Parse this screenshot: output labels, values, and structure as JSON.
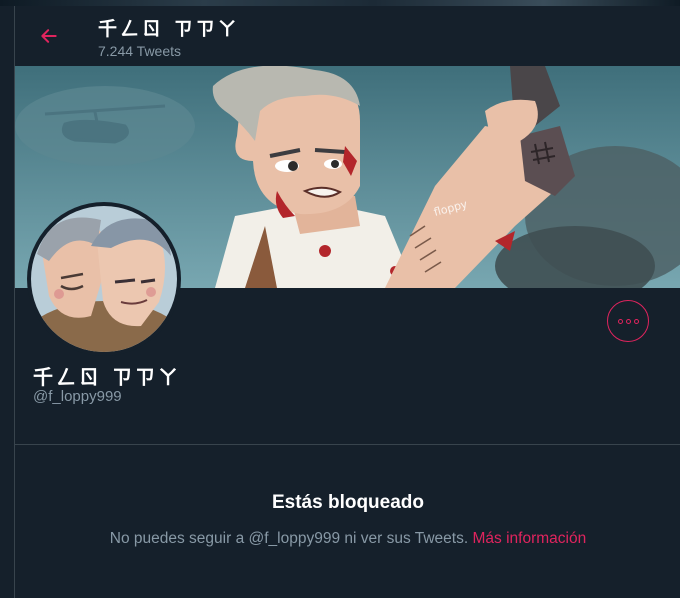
{
  "header": {
    "title": "千ㄥㄖ ㄗㄗㄚ",
    "tweet_count": "7.244 Tweets"
  },
  "profile": {
    "display_name": "千ㄥㄖ ㄗㄗㄚ",
    "handle": "@f_loppy999"
  },
  "banner": {
    "signature": "floppy"
  },
  "blocked": {
    "title": "Estás bloqueado",
    "message": "No puedes seguir a @f_loppy999 ni ver sus Tweets.",
    "link": "Más información"
  },
  "colors": {
    "background": "#15202b",
    "accent": "#e0245e",
    "secondary_text": "#8899a6",
    "border": "#38444d"
  },
  "icons": {
    "back": "arrow-left-icon",
    "more": "more-horizontal-icon"
  }
}
